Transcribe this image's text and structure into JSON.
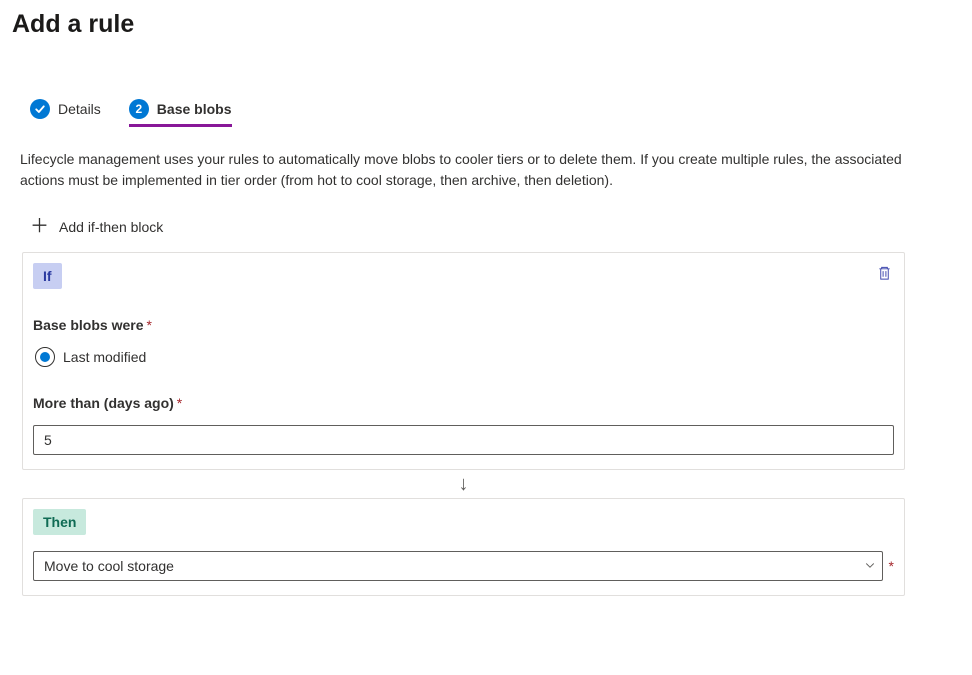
{
  "page": {
    "title": "Add a rule"
  },
  "tabs": {
    "details": {
      "label": "Details"
    },
    "baseblobs": {
      "number": "2",
      "label": "Base blobs"
    }
  },
  "description": "Lifecycle management uses your rules to automatically move blobs to cooler tiers or to delete them. If you create multiple rules, the associated actions must be implemented in tier order (from hot to cool storage, then archive, then deletion).",
  "addBlock": "Add if-then block",
  "ifBlock": {
    "chip": "If",
    "conditionLabel": "Base blobs were",
    "radioOption": "Last modified",
    "daysLabel": "More than (days ago)",
    "daysValue": "5"
  },
  "thenBlock": {
    "chip": "Then",
    "actionValue": "Move to cool storage"
  }
}
